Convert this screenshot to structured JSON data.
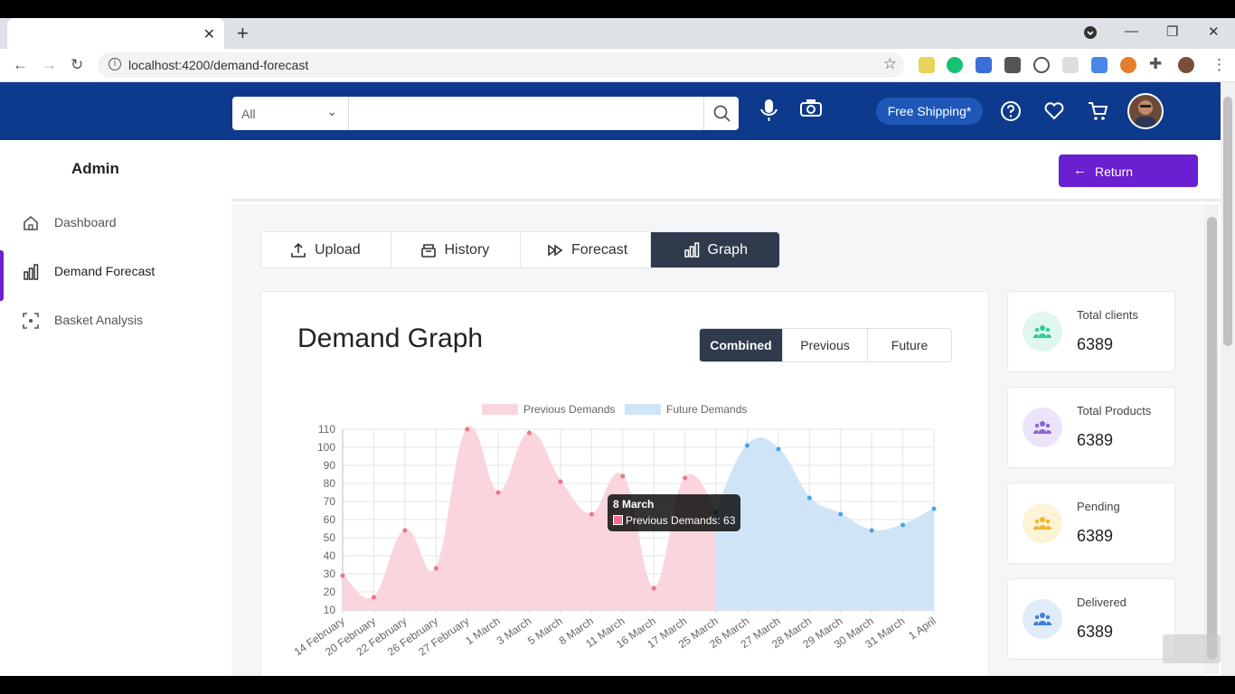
{
  "browser": {
    "url": "localhost:4200/demand-forecast"
  },
  "header": {
    "search_category": "All",
    "search_placeholder": "",
    "free_shipping": "Free Shipping*"
  },
  "sidebar": {
    "title": "Admin",
    "items": [
      {
        "label": "Dashboard",
        "icon": "home-icon"
      },
      {
        "label": "Demand Forecast",
        "icon": "bar-chart-icon",
        "active": true
      },
      {
        "label": "Basket Analysis",
        "icon": "scan-icon"
      }
    ]
  },
  "return_label": "Return",
  "tabs": [
    {
      "label": "Upload",
      "icon": "upload-icon"
    },
    {
      "label": "History",
      "icon": "archive-icon"
    },
    {
      "label": "Forecast",
      "icon": "fast-forward-icon"
    },
    {
      "label": "Graph",
      "icon": "bar-chart-icon",
      "active": true
    }
  ],
  "card": {
    "title": "Demand Graph",
    "segments": [
      "Combined",
      "Previous",
      "Future"
    ],
    "active_segment": "Combined"
  },
  "stats": [
    {
      "label": "Total clients",
      "value": "6389",
      "color": "#2ecc9a",
      "bg": "#dff7ee"
    },
    {
      "label": "Total Products",
      "value": "6389",
      "color": "#8a64d6",
      "bg": "#ece4fa"
    },
    {
      "label": "Pending",
      "value": "6389",
      "color": "#f0b429",
      "bg": "#fdf3d6"
    },
    {
      "label": "Delivered",
      "value": "6389",
      "color": "#3d7fd9",
      "bg": "#e1ecfa"
    }
  ],
  "tooltip": {
    "title": "8 March",
    "body": "Previous Demands: 63"
  },
  "chart_data": {
    "type": "area",
    "categories": [
      "14 February",
      "20 February",
      "22 February",
      "26 February",
      "27 February",
      "1 March",
      "3 March",
      "5 March",
      "8 March",
      "11 March",
      "16 March",
      "17 March",
      "25 March",
      "26 March",
      "27 March",
      "28 March",
      "29 March",
      "30 March",
      "31 March",
      "1 April"
    ],
    "series": [
      {
        "name": "Previous Demands",
        "color": "#f0728a",
        "fill": "#fbd5dd",
        "values": [
          29,
          17,
          54,
          33,
          110,
          75,
          108,
          81,
          63,
          84,
          22,
          83,
          64,
          null,
          null,
          null,
          null,
          null,
          null,
          null
        ]
      },
      {
        "name": "Future Demands",
        "color": "#4aa3e6",
        "fill": "#cfe5f7",
        "values": [
          null,
          null,
          null,
          null,
          null,
          null,
          null,
          null,
          null,
          null,
          null,
          null,
          64,
          101,
          99,
          72,
          63,
          54,
          57,
          66
        ]
      }
    ],
    "yticks": [
      10,
      20,
      30,
      40,
      50,
      60,
      70,
      80,
      90,
      100,
      110
    ],
    "ylim": [
      10,
      110
    ],
    "legend": "top"
  }
}
